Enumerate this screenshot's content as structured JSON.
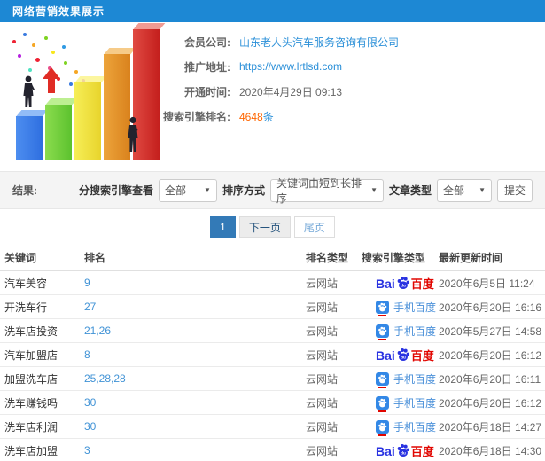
{
  "header": {
    "title": "网络营销效果展示"
  },
  "info": {
    "company_label": "会员公司:",
    "company_value": "山东老人头汽车服务咨询有限公司",
    "url_label": "推广地址:",
    "url_value": "https://www.lrtlsd.com",
    "open_time_label": "开通时间:",
    "open_time_value": "2020年4月29日 09:13",
    "rank_count_label": "搜索引擎排名:",
    "rank_count_value": "4648",
    "rank_count_suffix": "条"
  },
  "filters": {
    "result_label": "结果:",
    "engine_label": "分搜索引擎查看",
    "engine_selected": "全部",
    "sort_label": "排序方式",
    "sort_selected": "关键词由短到长排序",
    "article_label": "文章类型",
    "article_selected": "全部",
    "submit_label": "提交"
  },
  "pagination": {
    "current": "1",
    "next": "下一页",
    "last": "尾页"
  },
  "table": {
    "headers": [
      "关键词",
      "排名",
      "排名类型",
      "搜索引擎类型",
      "最新更新时间"
    ],
    "engine_logo": {
      "baidu_pc_latin": "Bai",
      "baidu_pc_cn": "百度",
      "baidu_mobile_text": "手机百度"
    },
    "rows": [
      {
        "keyword": "汽车美容",
        "rank": "9",
        "rank_type": "云网站",
        "engine": "baidu-pc",
        "updated": "2020年6月5日 11:24"
      },
      {
        "keyword": "开洗车行",
        "rank": "27",
        "rank_type": "云网站",
        "engine": "baidu-mobile",
        "updated": "2020年6月20日 16:16"
      },
      {
        "keyword": "洗车店投资",
        "rank": "21,26",
        "rank_type": "云网站",
        "engine": "baidu-mobile",
        "updated": "2020年5月27日 14:58"
      },
      {
        "keyword": "汽车加盟店",
        "rank": "8",
        "rank_type": "云网站",
        "engine": "baidu-pc",
        "updated": "2020年6月20日 16:12"
      },
      {
        "keyword": "加盟洗车店",
        "rank": "25,28,28",
        "rank_type": "云网站",
        "engine": "baidu-mobile",
        "updated": "2020年6月20日 16:11"
      },
      {
        "keyword": "洗车赚钱吗",
        "rank": "30",
        "rank_type": "云网站",
        "engine": "baidu-mobile",
        "updated": "2020年6月20日 16:12"
      },
      {
        "keyword": "洗车店利润",
        "rank": "30",
        "rank_type": "云网站",
        "engine": "baidu-mobile",
        "updated": "2020年6月18日 14:27"
      },
      {
        "keyword": "洗车店加盟",
        "rank": "3",
        "rank_type": "云网站",
        "engine": "baidu-pc",
        "updated": "2020年6月18日 14:30"
      }
    ]
  },
  "colors": {
    "header_bg": "#1d88d4",
    "link_blue": "#2a8fd8",
    "highlight_orange": "#ff6600",
    "baidu_blue": "#2932e1",
    "baidu_red": "#e10601",
    "pager_active": "#337ab7"
  }
}
